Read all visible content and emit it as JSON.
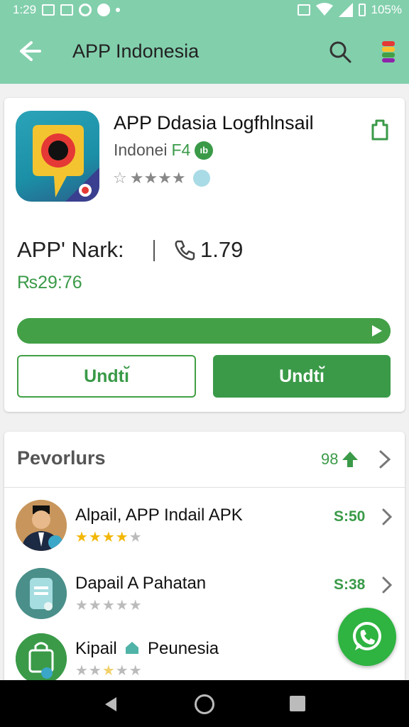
{
  "status_bar": {
    "time": "1:29",
    "battery": "105%"
  },
  "toolbar": {
    "title": "APP Indonesia",
    "back_icon": "arrow-left-icon",
    "search_icon": "search-icon",
    "menu_icon": "colorful-menu-icon"
  },
  "app": {
    "name": "APP Ddasia Logfhlnsail",
    "developer": "Indonei",
    "developer_suffix": "F4",
    "developer_badge": "ıb",
    "stars": "★★★★",
    "mark_label": "APP' Nark:",
    "mark_value": "1.79",
    "price": "₨29:76",
    "progress_percent": 100,
    "button_outline": "Undtı̆",
    "button_filled": "Undtı̆",
    "colors": {
      "header": "#82cfac",
      "accent": "#3a9a48",
      "icon_bg": "#1b8fa6"
    }
  },
  "section": {
    "title": "Pevorlurs",
    "count": "98"
  },
  "list": [
    {
      "title": "Alpail, APP Indail APK",
      "price": "S:50",
      "rating": 4,
      "avatar_icon": "person-avatar-icon"
    },
    {
      "title": "Dapail A Pahatan",
      "price": "S:38",
      "rating": 0,
      "avatar_icon": "tablet-icon"
    },
    {
      "title": "Kipail",
      "title_suffix": "Peunesia",
      "price": "",
      "rating": 1,
      "avatar_icon": "shopping-bag-icon"
    }
  ],
  "fab_icon": "whatsapp-icon"
}
